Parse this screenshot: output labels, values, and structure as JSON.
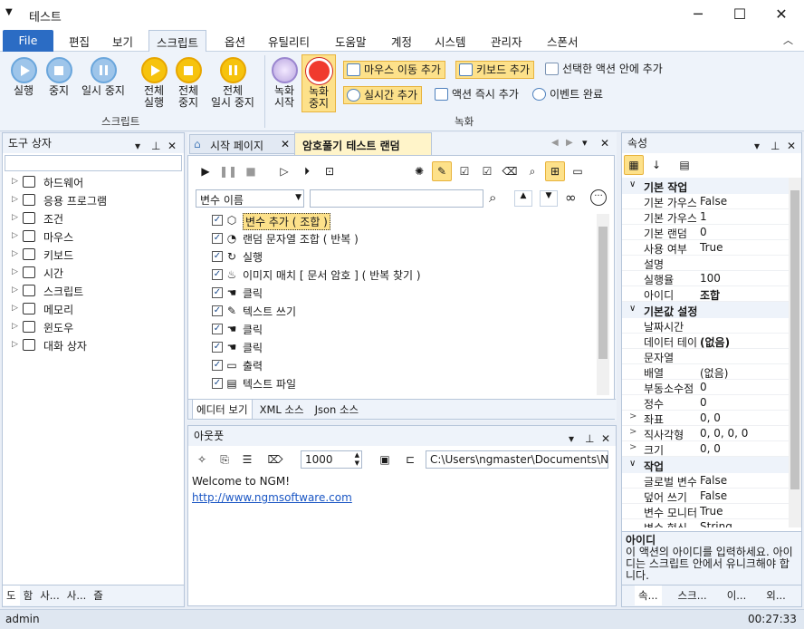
{
  "window": {
    "title": "테스트",
    "minimize": "─",
    "maximize": "☐",
    "close": "✕",
    "sysmenu": "▼"
  },
  "menu": {
    "file": "File",
    "items": [
      "편집",
      "보기",
      "스크립트",
      "옵션",
      "유틸리티",
      "도움말",
      "계정",
      "시스템",
      "관리자",
      "스폰서"
    ],
    "active": "스크립트",
    "collapse": "︿"
  },
  "ribbon": {
    "script": {
      "run": "실행",
      "stop": "중지",
      "pause": "일시 중지",
      "run_all_1": "전체",
      "run_all_2": "실행",
      "stop_all_1": "전체",
      "stop_all_2": "중지",
      "pause_all_1": "전체",
      "pause_all_2": "일시 중지",
      "group": "스크립트"
    },
    "record": {
      "start_1": "녹화",
      "start_2": "시작",
      "stop_1": "녹화",
      "stop_2": "중지",
      "mouse_move": "마우스 이동 추가",
      "key_add": "키보드 추가",
      "add_selected": "선택한 액션 안에 추가",
      "realtime": "실시간 추가",
      "immediate": "액션 즉시 추가",
      "event_done": "이벤트 완료",
      "group": "녹화"
    }
  },
  "toolbox": {
    "title": "도구 상자",
    "pin": "▾ ⊥ ✕",
    "items": [
      "하드웨어",
      "응용 프로그램",
      "조건",
      "마우스",
      "키보드",
      "시간",
      "스크립트",
      "메모리",
      "윈도우",
      "대화 상자"
    ],
    "tabs": [
      "도",
      "함",
      "사...",
      "사...",
      "즐"
    ]
  },
  "editor": {
    "tabs": [
      "시작 페이지",
      "암호풀기 테스트 랜덤"
    ],
    "var_select": "변수 이름",
    "actions": [
      {
        "label": "변수 추가 ( 조합 )",
        "icon": "⬡"
      },
      {
        "label": "랜덤 문자열 조합 ( 반복 )",
        "icon": "◔"
      },
      {
        "label": "실행",
        "icon": "↻"
      },
      {
        "label": "이미지 매치 [ 문서 암호 ] ( 반복 찾기 )",
        "icon": "♨"
      },
      {
        "label": "클릭",
        "icon": "☚"
      },
      {
        "label": "텍스트 쓰기",
        "icon": "✎"
      },
      {
        "label": "클릭",
        "icon": "☚"
      },
      {
        "label": "클릭",
        "icon": "☚"
      },
      {
        "label": "출력",
        "icon": "▭"
      },
      {
        "label": "텍스트 파일",
        "icon": "▤"
      }
    ],
    "bottom_tabs": [
      "에디터 보기",
      "XML 소스",
      "Json 소스"
    ]
  },
  "output": {
    "title": "아웃풋",
    "count": "1000",
    "path": "C:\\Users\\ngmaster\\Documents\\NGM",
    "lines": [
      "Welcome to NGM!",
      "http://www.ngmsoftware.com"
    ]
  },
  "properties": {
    "title": "속성",
    "sections": [
      {
        "name": "기본 작업",
        "rows": [
          [
            "기본 가우스",
            "False"
          ],
          [
            "기본 가우스",
            "1"
          ],
          [
            "기본 랜덤",
            "0"
          ],
          [
            "사용 여부",
            "True"
          ],
          [
            "설명",
            ""
          ],
          [
            "실행율",
            "100"
          ],
          [
            "아이디",
            "조합"
          ]
        ]
      },
      {
        "name": "기본값 설정",
        "rows": [
          [
            "날짜시간",
            ""
          ],
          [
            "데이터 테이블",
            "(없음)"
          ],
          [
            "문자열",
            ""
          ],
          [
            "배열",
            "(없음)"
          ],
          [
            "부동소수점",
            "0"
          ],
          [
            "정수",
            "0"
          ],
          [
            "좌표",
            "0, 0"
          ],
          [
            "직사각형",
            "0, 0, 0, 0"
          ],
          [
            "크기",
            "0, 0"
          ]
        ]
      },
      {
        "name": "작업",
        "rows": [
          [
            "글로벌 변수",
            "False"
          ],
          [
            "덮어 쓰기",
            "False"
          ],
          [
            "변수 모니터",
            "True"
          ],
          [
            "변수 형식",
            "String"
          ]
        ]
      }
    ],
    "desc_title": "아이디",
    "desc": "이 액션의 아이디를 입력하세요. 아이디는 스크립트 안에서 유니크해야 합니다.",
    "tabs": [
      "속...",
      "스크...",
      "이...",
      "외..."
    ]
  },
  "status": {
    "user": "admin",
    "time": "00:27:33"
  }
}
